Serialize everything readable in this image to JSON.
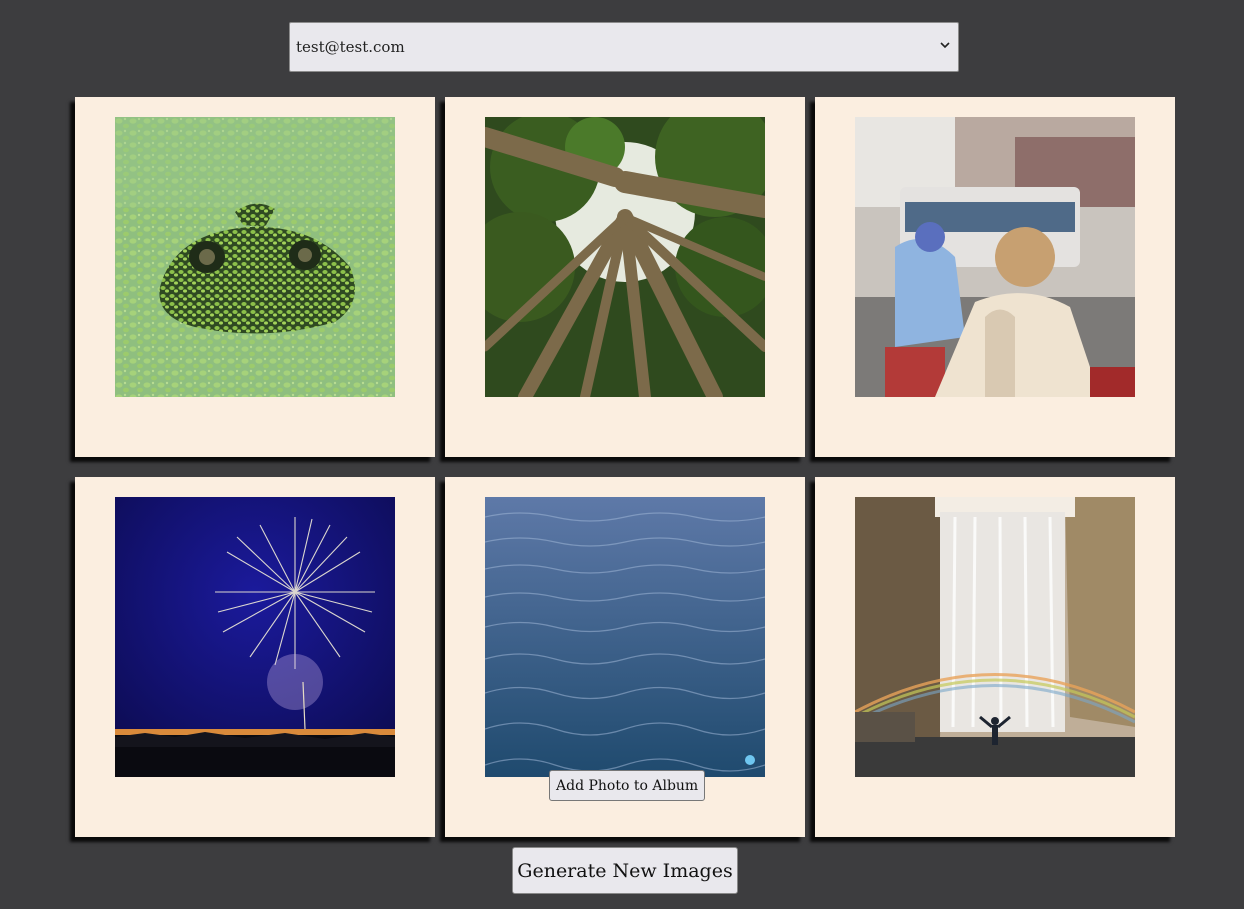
{
  "user_select": {
    "selected": "test@test.com"
  },
  "photos": [
    {
      "subject": "frog-in-duckweed"
    },
    {
      "subject": "forest-canopy"
    },
    {
      "subject": "street-scooters"
    },
    {
      "subject": "fireworks"
    },
    {
      "subject": "ocean-water",
      "hover_button": "Add Photo to Album"
    },
    {
      "subject": "waterfall-rainbow"
    }
  ],
  "generate_button": {
    "label": "Generate New Images"
  },
  "colors": {
    "background": "#3d3d3f",
    "card": "#fbeee0",
    "button": "#e9e8ed"
  }
}
